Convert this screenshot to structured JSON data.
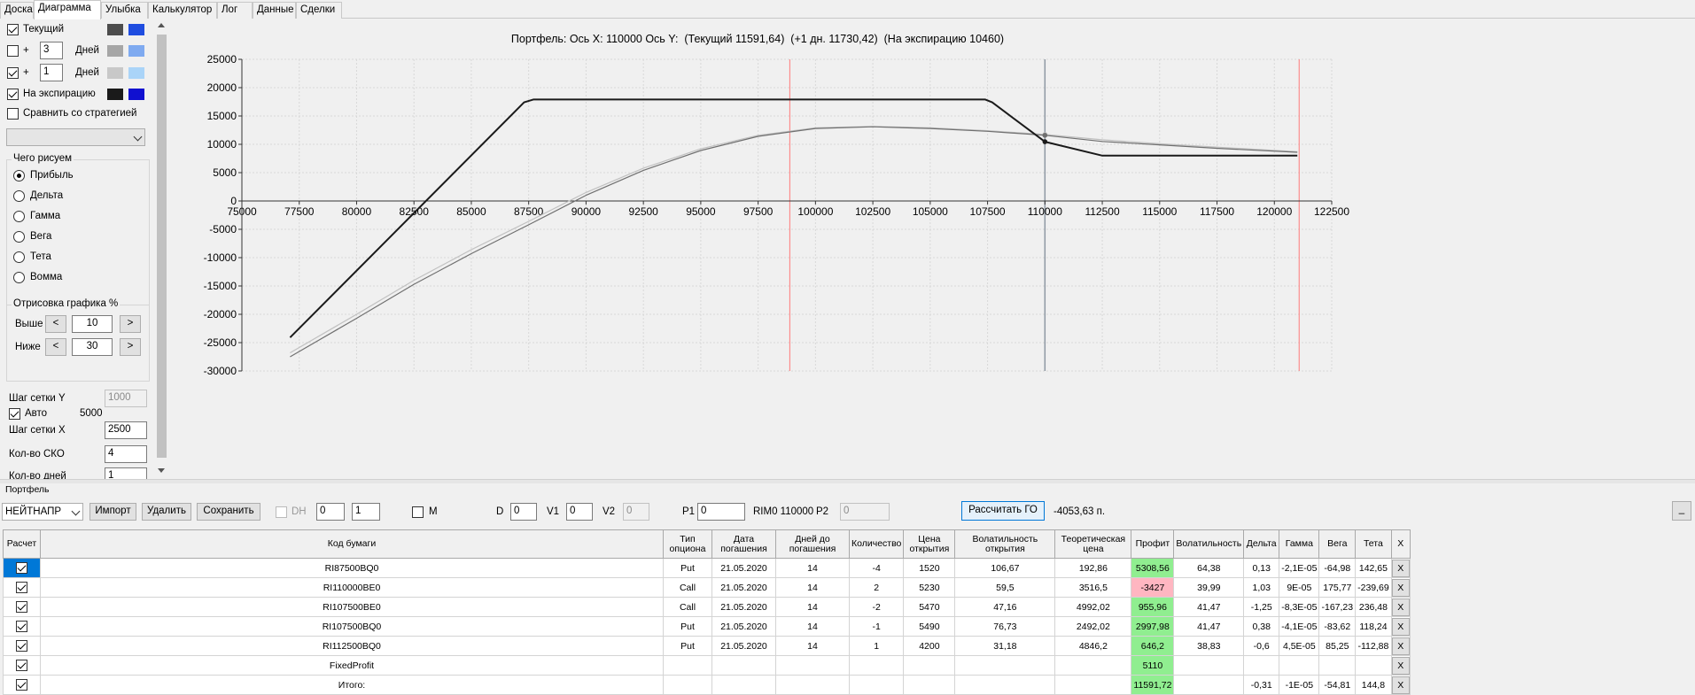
{
  "tabs": [
    "Доска",
    "Диаграмма",
    "Улыбка",
    "Калькулятор",
    "Лог",
    "Данные",
    "Сделки"
  ],
  "sidebar": {
    "current_label": "Текущий",
    "plus": "+",
    "days_label": "Дней",
    "days1": "3",
    "days2": "1",
    "expiry_label": "На экспирацию",
    "compare_label": "Сравнить со стратегией",
    "what_title": "Чего рисуем",
    "what_options": [
      "Прибыль",
      "Дельта",
      "Гамма",
      "Вега",
      "Тета",
      "Вомма"
    ],
    "draw_title": "Отрисовка графика %",
    "above_label": "Выше",
    "below_label": "Ниже",
    "above_value": "10",
    "below_value": "30",
    "grid_y_label": "Шаг сетки Y",
    "grid_y_value": "1000",
    "auto_label": "Авто",
    "auto_value": "5000",
    "grid_x_label": "Шаг сетки X",
    "grid_x_value": "2500",
    "sko_label": "Кол-во СКО",
    "sko_value": "4",
    "days_count_label": "Кол-во дней",
    "days_count_value": "1",
    "swatch_colors": [
      "#4d4d4d",
      "#1f4de0",
      "#a6a6a6",
      "#7faaf0",
      "#c8c8c8",
      "#aad4f8",
      "#1a1a1a",
      "#1010d0"
    ]
  },
  "chart_title": "Портфель: Ось X: 110000 Ось Y:  (Текущий 11591,64)  (+1 дн. 11730,42)  (На экспирацию 10460)",
  "chart_data": {
    "type": "line",
    "xlim": [
      75000,
      122500
    ],
    "ylim": [
      -30000,
      25000
    ],
    "x_ticks": [
      "75000",
      "77500",
      "80000",
      "82500",
      "85000",
      "87500",
      "90000",
      "92500",
      "95000",
      "97500",
      "100000",
      "102500",
      "105000",
      "107500",
      "110000",
      "112500",
      "115000",
      "117500",
      "120000",
      "122500"
    ],
    "y_ticks": [
      "25000",
      "20000",
      "15000",
      "10000",
      "5000",
      "0",
      "-5000",
      "-10000",
      "-15000",
      "-20000",
      "-25000",
      "-30000"
    ],
    "grid": true,
    "vlines_red": [
      98880,
      121080
    ],
    "vline_axis": 110000,
    "series": [
      {
        "color": "#1a1a1a",
        "x": [
          77100,
          87300,
          87700,
          107400,
          107700,
          110000,
          112500,
          121000
        ],
        "values": [
          -24100,
          17400,
          17900,
          17900,
          17400,
          10460,
          8000,
          8000
        ]
      },
      {
        "color": "#707070",
        "x": [
          77100,
          80000,
          82500,
          85000,
          87500,
          90000,
          92500,
          95000,
          97500,
          100000,
          102500,
          105000,
          107500,
          110000,
          112500,
          115000,
          117500,
          121000
        ],
        "values": [
          -27500,
          -20700,
          -14700,
          -9300,
          -4200,
          1000,
          5400,
          8900,
          11400,
          12800,
          13100,
          12800,
          12300,
          11591.64,
          10500,
          9900,
          9300,
          8600
        ]
      },
      {
        "color": "#c0c0c0",
        "x": [
          77100,
          80000,
          82500,
          85000,
          87500,
          90000,
          92500,
          95000,
          97500,
          100000,
          102500,
          105000,
          107500,
          110000,
          112500,
          115000,
          117500,
          121000
        ],
        "values": [
          -26800,
          -20000,
          -14000,
          -8600,
          -3600,
          1500,
          5800,
          9200,
          11600,
          12900,
          13150,
          12900,
          12400,
          11730.42,
          10800,
          10100,
          9500,
          8700
        ]
      }
    ]
  },
  "portfolio": {
    "label": "Портфель",
    "select": "НЕЙТНАПР",
    "btn_import": "Импорт",
    "btn_delete": "Удалить",
    "btn_save": "Сохранить",
    "dh_label": "DH",
    "dh_v1": "0",
    "dh_v2": "1",
    "m_label": "M",
    "d_label": "D",
    "d_value": "0",
    "v1_label": "V1",
    "v1_value": "0",
    "v2_label": "V2",
    "v2_value": "0",
    "p1_label": "P1",
    "p1_value": "0",
    "rim_label": "RIM0 110000",
    "p2_label": "P2",
    "p2_value": "0",
    "calc_button": "Рассчитать ГО",
    "go_value": "-4053,63 п.",
    "underscore_button": "_"
  },
  "table": {
    "headers": [
      "Расчет",
      "Код бумаги",
      "Тип опциона",
      "Дата погашения",
      "Дней до погашения",
      "Количество",
      "Цена открытия",
      "Волатильность открытия",
      "Теоретическая цена",
      "Профит",
      "Волатильность",
      "Дельта",
      "Гамма",
      "Вега",
      "Тета",
      "X"
    ],
    "rows": [
      {
        "code": "RI87500BQ0",
        "type": "Put",
        "date": "21.05.2020",
        "days": "14",
        "qty": "-4",
        "price": "1520",
        "vol_open": "106,67",
        "theo": "192,86",
        "profit": "5308,56",
        "vol": "64,38",
        "delta": "0,13",
        "gamma": "-2,1E-05",
        "vega": "-64,98",
        "theta": "142,65",
        "x": "X"
      },
      {
        "code": "RI110000BE0",
        "type": "Call",
        "date": "21.05.2020",
        "days": "14",
        "qty": "2",
        "price": "5230",
        "vol_open": "59,5",
        "theo": "3516,5",
        "profit": "-3427",
        "vol": "39,99",
        "delta": "1,03",
        "gamma": "9E-05",
        "vega": "175,77",
        "theta": "-239,69",
        "x": "X"
      },
      {
        "code": "RI107500BE0",
        "type": "Call",
        "date": "21.05.2020",
        "days": "14",
        "qty": "-2",
        "price": "5470",
        "vol_open": "47,16",
        "theo": "4992,02",
        "profit": "955,96",
        "vol": "41,47",
        "delta": "-1,25",
        "gamma": "-8,3E-05",
        "vega": "-167,23",
        "theta": "236,48",
        "x": "X"
      },
      {
        "code": "RI107500BQ0",
        "type": "Put",
        "date": "21.05.2020",
        "days": "14",
        "qty": "-1",
        "price": "5490",
        "vol_open": "76,73",
        "theo": "2492,02",
        "profit": "2997,98",
        "vol": "41,47",
        "delta": "0,38",
        "gamma": "-4,1E-05",
        "vega": "-83,62",
        "theta": "118,24",
        "x": "X"
      },
      {
        "code": "RI112500BQ0",
        "type": "Put",
        "date": "21.05.2020",
        "days": "14",
        "qty": "1",
        "price": "4200",
        "vol_open": "31,18",
        "theo": "4846,2",
        "profit": "646,2",
        "vol": "38,83",
        "delta": "-0,6",
        "gamma": "4,5E-05",
        "vega": "85,25",
        "theta": "-112,88",
        "x": "X"
      },
      {
        "code": "FixedProfit",
        "type": "",
        "date": "",
        "days": "",
        "qty": "",
        "price": "",
        "vol_open": "",
        "theo": "",
        "profit": "5110",
        "vol": "",
        "delta": "",
        "gamma": "",
        "vega": "",
        "theta": "",
        "x": "X"
      },
      {
        "code": "Итого:",
        "type": "",
        "date": "",
        "days": "",
        "qty": "",
        "price": "",
        "vol_open": "",
        "theo": "",
        "profit": "11591,72",
        "vol": "",
        "delta": "-0,31",
        "gamma": "-1E-05",
        "vega": "-54,81",
        "theta": "144,8",
        "x": "X"
      }
    ],
    "profit_green": "#90ee90",
    "profit_red": "#ffb6c1",
    "row_checkbox_color": "#0078d7"
  }
}
